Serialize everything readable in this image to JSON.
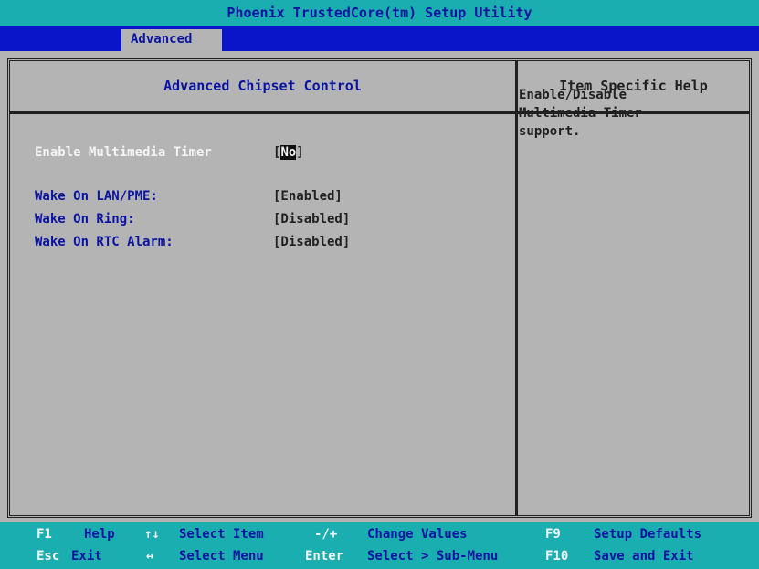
{
  "app_title": "Phoenix TrustedCore(tm) Setup Utility",
  "menu": {
    "active_tab": "Advanced"
  },
  "section": {
    "title": "Advanced Chipset Control",
    "help_title": "Item Specific Help"
  },
  "settings": [
    {
      "label": "Enable Multimedia Timer",
      "value_open": "[",
      "value_selected": "No",
      "value_close": "]"
    },
    {
      "label": "Wake On LAN/PME:",
      "value": "[Enabled]"
    },
    {
      "label": "Wake On Ring:",
      "value": "[Disabled]"
    },
    {
      "label": "Wake On RTC Alarm:",
      "value": "[Disabled]"
    }
  ],
  "help_text": [
    "Enable/Disable",
    "Multimedia Timer",
    "support."
  ],
  "footer": {
    "row1": [
      {
        "key": "F1",
        "desc": "Help"
      },
      {
        "key": "↑↓",
        "desc": "Select Item"
      },
      {
        "key": "-/+",
        "desc": "Change Values"
      },
      {
        "key": "F9",
        "desc": "Setup Defaults"
      }
    ],
    "row2": [
      {
        "key": "Esc",
        "desc": "Exit"
      },
      {
        "key": "↔",
        "desc": "Select Menu"
      },
      {
        "key": "Enter",
        "desc": "Select > Sub-Menu"
      },
      {
        "key": "F10",
        "desc": "Save and Exit"
      }
    ]
  },
  "colors": {
    "title_bar": "#1aaeb0",
    "menu_bar": "#0a14c8",
    "panel": "#b4b4b4",
    "label_blue": "#0a14a0",
    "highlight_white": "#f4f4f4"
  }
}
